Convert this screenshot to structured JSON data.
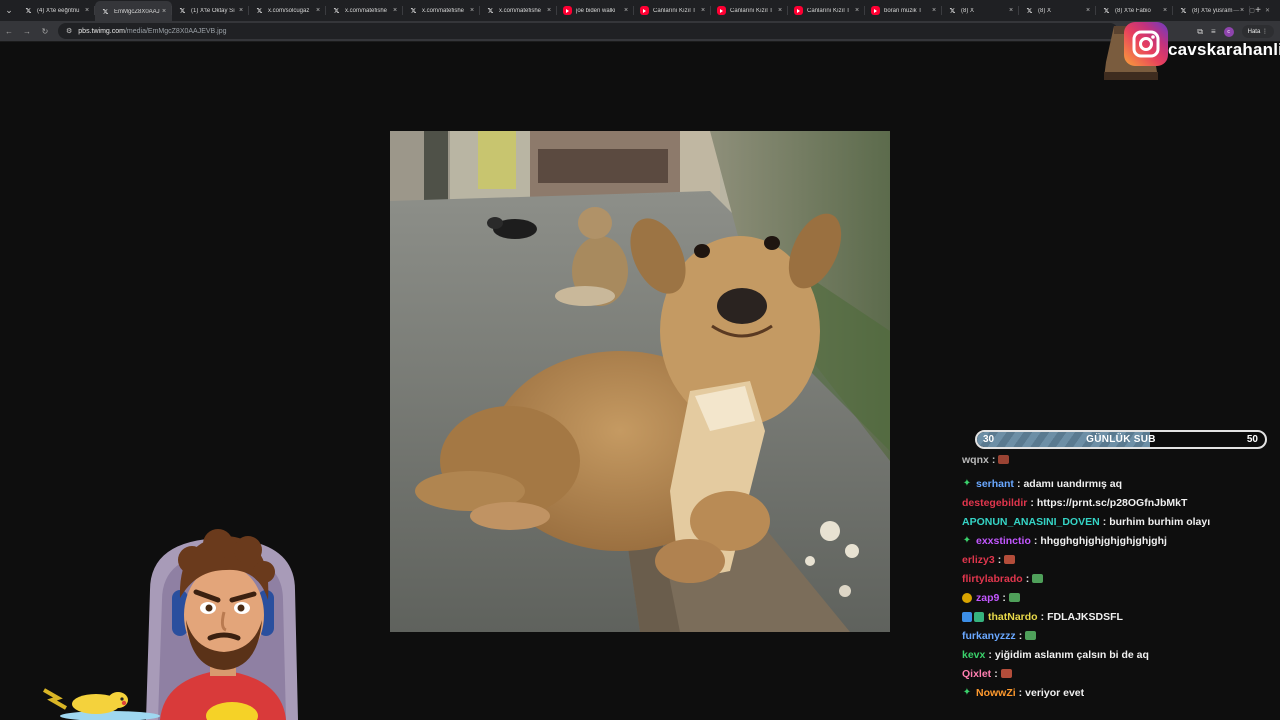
{
  "browser": {
    "tabs": [
      {
        "title": "(4) X'te eeğntriu",
        "icon": "x-icon",
        "active": false
      },
      {
        "title": "EmMgcZ8X0AAJ",
        "icon": "x-icon",
        "active": true
      },
      {
        "title": "(1) X'te Oktay Sı",
        "icon": "x-icon",
        "active": false
      },
      {
        "title": "x.com/solcugaz",
        "icon": "x-icon",
        "active": false
      },
      {
        "title": "x.com/natefishe",
        "icon": "x-icon",
        "active": false
      },
      {
        "title": "x.com/natefishe",
        "icon": "x-icon",
        "active": false
      },
      {
        "title": "x.com/natefishe",
        "icon": "x-icon",
        "active": false
      },
      {
        "title": "joe biden walki",
        "icon": "youtube-icon",
        "active": false
      },
      {
        "title": "Canlarını Kızıl T",
        "icon": "youtube-icon",
        "active": false
      },
      {
        "title": "Canlarını Kızıl T",
        "icon": "youtube-icon",
        "active": false
      },
      {
        "title": "Canlarını Kızıl T",
        "icon": "youtube-icon",
        "active": false
      },
      {
        "title": "boran müzik T",
        "icon": "youtube-icon",
        "active": false
      },
      {
        "title": "(8) X",
        "icon": "x-icon",
        "active": false
      },
      {
        "title": "(8) X",
        "icon": "x-icon",
        "active": false
      },
      {
        "title": "(8) X'te Fabio",
        "icon": "x-icon",
        "active": false
      },
      {
        "title": "(8) X'te yüsram",
        "icon": "x-icon",
        "active": false
      }
    ],
    "close_glyph": "×",
    "new_tab_glyph": "+",
    "url_host": "pbs.twimg.com",
    "url_path": "/media/EmMgcZ8X0AAJEVB.jpg",
    "profile_initial": "c",
    "error_chip": "Hata"
  },
  "overlay": {
    "instagram_handle": "cavskarahanli",
    "sub_goal": {
      "current": 30,
      "goal": 50,
      "label": "GÜNLÜK SUB"
    }
  },
  "chat": {
    "messages": [
      {
        "user": "wqnx",
        "color": "#d6d6d6",
        "badge": "none",
        "text": "",
        "emote": "brick",
        "partial": true
      },
      {
        "user": "serhant",
        "color": "#6aa8ff",
        "badge": "star",
        "text": "adamı uandırmış aq",
        "emote": ""
      },
      {
        "user": "destegebildir",
        "color": "#e0364d",
        "badge": "none",
        "text": "https://prnt.sc/p28OGfnJbMkT",
        "emote": ""
      },
      {
        "user": "APONUN_ANASINI_DOVEN",
        "color": "#35d4c6",
        "badge": "none",
        "text": "burhim burhim olayı",
        "emote": ""
      },
      {
        "user": "exxstinctio",
        "color": "#c257ff",
        "badge": "star",
        "text": "hhgghghjghjghjghjghjghj",
        "emote": ""
      },
      {
        "user": "erlizy3",
        "color": "#e0364d",
        "badge": "none",
        "text": "",
        "emote": "brick"
      },
      {
        "user": "flirtylabrado",
        "color": "#e0364d",
        "badge": "none",
        "text": "",
        "emote": "frog"
      },
      {
        "user": "zap9",
        "color": "#c257ff",
        "badge": "gold",
        "text": "",
        "emote": "frog"
      },
      {
        "user": "thatNardo",
        "color": "#e7d84a",
        "badge": "cubes",
        "text": "FDLAJKSDSFL",
        "emote": ""
      },
      {
        "user": "furkanyzzz",
        "color": "#6aa8ff",
        "badge": "none",
        "text": "",
        "emote": "frog"
      },
      {
        "user": "kevx",
        "color": "#3ad16b",
        "badge": "none",
        "text": "yiğidim aslanım çalsın bi de aq",
        "emote": ""
      },
      {
        "user": "Qixlet",
        "color": "#ff7fb0",
        "badge": "none",
        "text": "",
        "emote": "brick"
      },
      {
        "user": "NowwZi",
        "color": "#ff9a2e",
        "badge": "star",
        "text": "veriyor evet",
        "emote": ""
      }
    ]
  }
}
